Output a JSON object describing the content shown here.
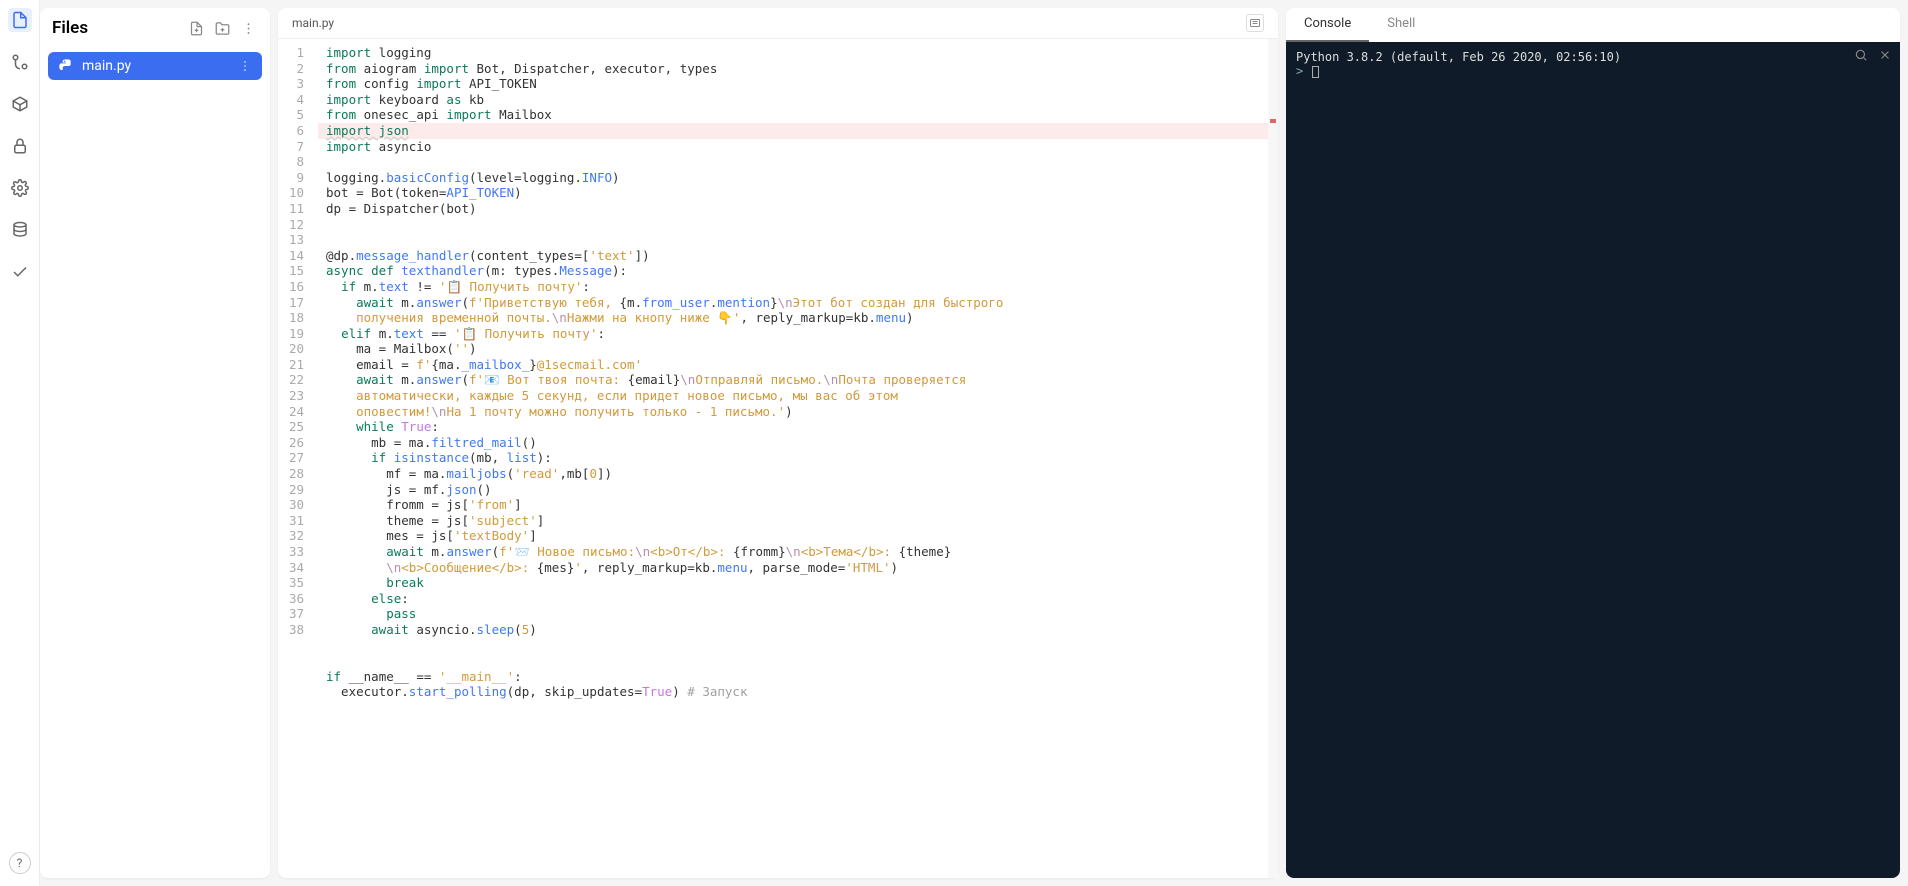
{
  "activity": {
    "items": [
      "files",
      "version",
      "package",
      "lock",
      "settings",
      "database",
      "check"
    ]
  },
  "files": {
    "title": "Files",
    "items": [
      {
        "name": "main.py",
        "active": true
      }
    ]
  },
  "editor": {
    "tab_label": "main.py",
    "lines": [
      {
        "n": 1,
        "html": "<span class='kw'>import</span> logging"
      },
      {
        "n": 2,
        "html": "<span class='kw'>from</span> aiogram <span class='kw'>import</span> Bot, Dispatcher, executor, types"
      },
      {
        "n": 3,
        "html": "<span class='kw'>from</span> config <span class='kw'>import</span> API_TOKEN"
      },
      {
        "n": 4,
        "html": "<span class='kw'>import</span> keyboard <span class='kw'>as</span> kb"
      },
      {
        "n": 5,
        "html": "<span class='kw'>from</span> onesec_api <span class='kw'>import</span> Mailbox"
      },
      {
        "n": 6,
        "html": "<span class='kw underline-wavy'>import json</span>",
        "err": true
      },
      {
        "n": 7,
        "html": "<span class='kw'>import</span> asyncio"
      },
      {
        "n": 8,
        "html": ""
      },
      {
        "n": 9,
        "html": "logging.<span class='fn'>basicConfig</span>(level=logging.<span class='fn'>INFO</span>)"
      },
      {
        "n": 10,
        "html": "bot = Bot(token=<span class='fn'>API_TOKEN</span>)"
      },
      {
        "n": 11,
        "html": "dp = Dispatcher(bot)"
      },
      {
        "n": 12,
        "html": ""
      },
      {
        "n": 13,
        "html": ""
      },
      {
        "n": 14,
        "html": "@dp.<span class='fn'>message_handler</span>(content_types=[<span class='str'>'text'</span>])"
      },
      {
        "n": 15,
        "html": "<span class='kw'>async def</span> <span class='fn'>texthandler</span>(m: types.<span class='fn'>Message</span>):"
      },
      {
        "n": 16,
        "html": "  <span class='kw'>if</span> m.<span class='fn'>text</span> != <span class='str'>'📋 Получить почту'</span>:"
      },
      {
        "n": 17,
        "html": "    <span class='kw'>await</span> m.<span class='fn'>answer</span>(<span class='str'>f'Приветствую тебя, </span>{m.<span class='fn'>from_user</span>.<span class='fn'>mention</span>}<span class='esc'>\\n</span><span class='str'>Этот бот создан для быстрого</span>",
        "soft": true
      },
      {
        "n": 17,
        "html": "    <span class='str'>получения временной почты.</span><span class='esc'>\\n</span><span class='str'>Нажми на кнопу ниже 👇'</span>, reply_markup=kb.<span class='fn'>menu</span>)",
        "cont": true
      },
      {
        "n": 18,
        "html": "  <span class='kw'>elif</span> m.<span class='fn'>text</span> == <span class='str'>'📋 Получить почту'</span>:"
      },
      {
        "n": 19,
        "html": "    ma = Mailbox(<span class='str'>''</span>)"
      },
      {
        "n": 20,
        "html": "    email = <span class='str'>f'</span>{ma.<span class='fn'>_mailbox_</span>}<span class='str'>@1secmail.com'</span>"
      },
      {
        "n": 21,
        "html": "    <span class='kw'>await</span> m.<span class='fn'>answer</span>(<span class='str'>f'📧 Вот твоя почта: </span>{email}<span class='esc'>\\n</span><span class='str'>Отправляй письмо.</span><span class='esc'>\\n</span><span class='str'>Почта проверяется</span>",
        "soft": true
      },
      {
        "n": 21,
        "html": "    <span class='str'>автоматически, каждые 5 секунд, если придет новое письмо, мы вас об этом</span>",
        "cont": true
      },
      {
        "n": 21,
        "html": "    <span class='str'>оповестим!</span><span class='esc'>\\n</span><span class='str'>На 1 почту можно получить только - 1 письмо.'</span>)",
        "cont": true
      },
      {
        "n": 22,
        "html": "    <span class='kw'>while</span> <span class='bool'>True</span>:"
      },
      {
        "n": 23,
        "html": "      mb = ma.<span class='fn'>filtred_mail</span>()"
      },
      {
        "n": 24,
        "html": "      <span class='kw'>if</span> <span class='fn'>isinstance</span>(mb, <span class='fn'>list</span>):"
      },
      {
        "n": 25,
        "html": "        mf = ma.<span class='fn'>mailjobs</span>(<span class='str'>'read'</span>,mb[<span class='str'>0</span>])"
      },
      {
        "n": 26,
        "html": "        js = mf.<span class='fn'>json</span>()"
      },
      {
        "n": 27,
        "html": "        fromm = js[<span class='str'>'from'</span>]"
      },
      {
        "n": 28,
        "html": "        theme = js[<span class='str'>'subject'</span>]"
      },
      {
        "n": 29,
        "html": "        mes = js[<span class='str'>'textBody'</span>]"
      },
      {
        "n": 30,
        "html": "        <span class='kw'>await</span> m.<span class='fn'>answer</span>(<span class='str'>f'📨 Новое письмо:</span><span class='esc'>\\n</span><span class='str'>&lt;b&gt;От&lt;/b&gt;: </span>{fromm}<span class='esc'>\\n</span><span class='str'>&lt;b&gt;Тема&lt;/b&gt;: </span>{theme}",
        "soft": true
      },
      {
        "n": 30,
        "html": "        <span class='esc'>\\n</span><span class='str'>&lt;b&gt;Сообщение&lt;/b&gt;: </span>{mes}<span class='str'>'</span>, reply_markup=kb.<span class='fn'>menu</span>, parse_mode=<span class='str'>'HTML'</span>)",
        "cont": true
      },
      {
        "n": 31,
        "html": "        <span class='kw'>break</span>"
      },
      {
        "n": 32,
        "html": "      <span class='kw'>else</span>:"
      },
      {
        "n": 33,
        "html": "        <span class='kw'>pass</span>"
      },
      {
        "n": 34,
        "html": "      <span class='kw'>await</span> asyncio.<span class='fn'>sleep</span>(<span class='str'>5</span>)"
      },
      {
        "n": 35,
        "html": ""
      },
      {
        "n": 36,
        "html": ""
      },
      {
        "n": 37,
        "html": "<span class='kw'>if</span> __name__ == <span class='str'>'__main__'</span>:"
      },
      {
        "n": 38,
        "html": "  executor.<span class='fn'>start_polling</span>(dp, skip_updates=<span class='bool'>True</span>) <span class='cmt'># Запуск</span>"
      }
    ]
  },
  "console": {
    "tabs": [
      {
        "label": "Console",
        "active": true
      },
      {
        "label": "Shell",
        "active": false
      }
    ],
    "banner": "Python 3.8.2 (default, Feb 26 2020, 02:56:10)",
    "prompt": ">"
  },
  "help": "?"
}
